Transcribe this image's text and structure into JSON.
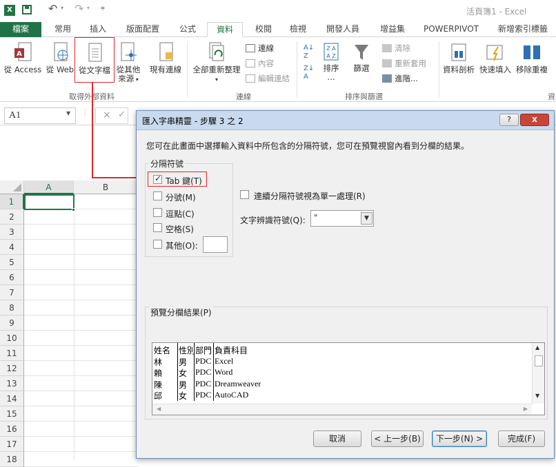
{
  "titlebar": {
    "app_icon": "excel-logo",
    "title": "活頁簿1 - Excel"
  },
  "tabs": [
    {
      "label": "檔案"
    },
    {
      "label": "常用"
    },
    {
      "label": "插入"
    },
    {
      "label": "版面配置"
    },
    {
      "label": "公式"
    },
    {
      "label": "資料"
    },
    {
      "label": "校閱"
    },
    {
      "label": "檢視"
    },
    {
      "label": "開發人員"
    },
    {
      "label": "增益集"
    },
    {
      "label": "POWERPIVOT"
    },
    {
      "label": "新增索引標籤"
    }
  ],
  "ribbon": {
    "external": {
      "access": "從 Access",
      "web": "從 Web",
      "text": "從文字檔",
      "other_line1": "從其他",
      "other_line2": "來源",
      "existing": "現有連線",
      "group": "取得外部資料"
    },
    "connections": {
      "refresh_all": "全部重新整理",
      "connections": "連線",
      "properties": "內容",
      "edit_links": "編輯連結",
      "group": "連線"
    },
    "sort": {
      "sort": "排序",
      "filter": "篩選",
      "clear": "清除",
      "reapply": "重新套用",
      "advanced": "進階...",
      "group": "排序與篩選"
    },
    "tools": {
      "text_to_columns": "資料剖析",
      "flash_fill": "快速填入",
      "remove_dup": "移除重複",
      "group_partial": "資"
    }
  },
  "namebox": {
    "value": "A1"
  },
  "formula": {
    "cancel": "×",
    "enter": "✓"
  },
  "grid": {
    "columns": [
      "A",
      "B"
    ],
    "rows": [
      "1",
      "2",
      "3",
      "4",
      "5",
      "6",
      "7",
      "8",
      "9",
      "10",
      "11",
      "12",
      "13",
      "14",
      "15",
      "16",
      "17",
      "18"
    ]
  },
  "dialog": {
    "title": "匯入字串精靈 - 步驟 3 之 2",
    "help_button": "?",
    "close_button": "x",
    "description": "您可在此畫面中選擇輸入資料中所包含的分隔符號，您可在預覽視窗內看到分欄的結果。",
    "delimiters_title": "分隔符號",
    "delimiters": [
      {
        "label": "Tab 鍵(T)",
        "checked": true
      },
      {
        "label": "分號(M)",
        "checked": false
      },
      {
        "label": "逗點(C)",
        "checked": false
      },
      {
        "label": "空格(S)",
        "checked": false
      },
      {
        "label": "其他(O):",
        "checked": false
      }
    ],
    "consecutive_label": "連續分隔符號視為單一處理(R)",
    "qualifier_label": "文字辨識符號(Q):",
    "qualifier_value": "\"",
    "preview_title": "預覽分欄結果(P)",
    "preview_rows": [
      [
        "姓名",
        "性別",
        "部門",
        "負責科目"
      ],
      [
        "林",
        "男",
        "PDC",
        "Excel"
      ],
      [
        "賴",
        "女",
        "PDC",
        "Word"
      ],
      [
        "陳",
        "男",
        "PDC",
        "Dreamweaver"
      ],
      [
        "邱",
        "女",
        "PDC",
        "AutoCAD"
      ]
    ],
    "buttons": {
      "cancel": "取消",
      "back": "< 上一步(B)",
      "next": "下一步(N) >",
      "finish": "完成(F)"
    }
  },
  "colors": {
    "excel_green": "#217346",
    "highlight_red": "#e0262a",
    "dialog_title_bg": "#c9daee"
  }
}
